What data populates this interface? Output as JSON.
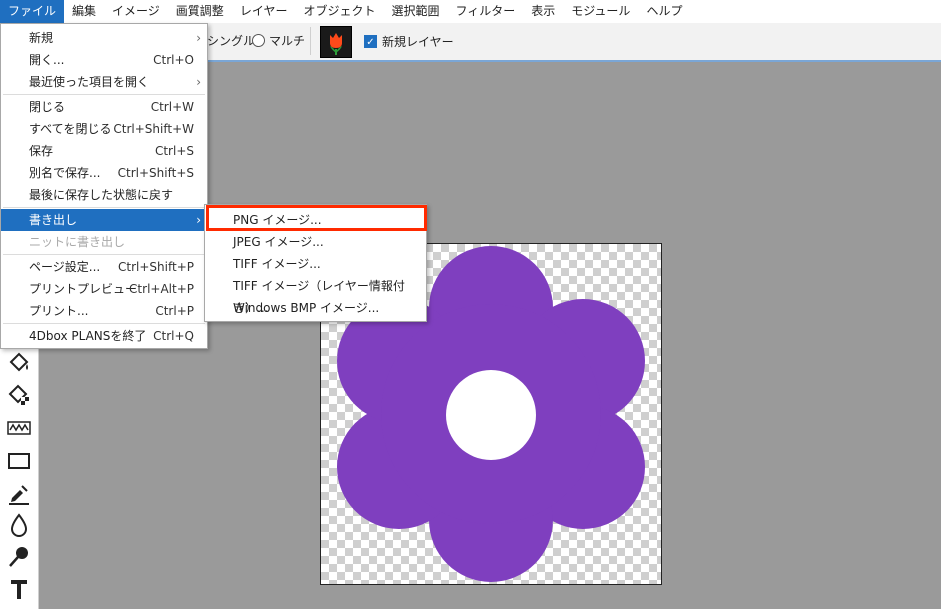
{
  "menubar": {
    "items": [
      "ファイル",
      "編集",
      "イメージ",
      "画質調整",
      "レイヤー",
      "オブジェクト",
      "選択範囲",
      "フィルター",
      "表示",
      "モジュール",
      "ヘルプ"
    ]
  },
  "toolbar": {
    "single_label": "シングル",
    "multi_label": "マルチ",
    "new_layer_label": "新規レイヤー",
    "new_layer_checked": true
  },
  "file_menu": {
    "items": [
      {
        "label": "新規",
        "shortcut": "",
        "submenu": true
      },
      {
        "label": "開く...",
        "shortcut": "Ctrl+O",
        "submenu": false
      },
      {
        "label": "最近使った項目を開く",
        "shortcut": "",
        "submenu": true
      },
      {
        "label": "閉じる",
        "shortcut": "Ctrl+W",
        "submenu": false
      },
      {
        "label": "すべてを閉じる",
        "shortcut": "Ctrl+Shift+W",
        "submenu": false
      },
      {
        "label": "保存",
        "shortcut": "Ctrl+S",
        "submenu": false
      },
      {
        "label": "別名で保存...",
        "shortcut": "Ctrl+Shift+S",
        "submenu": false
      },
      {
        "label": "最後に保存した状態に戻す",
        "shortcut": "",
        "submenu": false
      },
      {
        "label": "書き出し",
        "shortcut": "",
        "submenu": true
      },
      {
        "label": "ニットに書き出し",
        "shortcut": "",
        "submenu": false
      },
      {
        "label": "ページ設定...",
        "shortcut": "Ctrl+Shift+P",
        "submenu": false
      },
      {
        "label": "プリントプレビュー",
        "shortcut": "Ctrl+Alt+P",
        "submenu": false
      },
      {
        "label": "プリント...",
        "shortcut": "Ctrl+P",
        "submenu": false
      },
      {
        "label": "4Dbox PLANSを終了",
        "shortcut": "Ctrl+Q",
        "submenu": false
      }
    ]
  },
  "export_submenu": {
    "items": [
      "PNG イメージ...",
      "JPEG イメージ...",
      "TIFF イメージ...",
      "TIFF イメージ（レイヤー情報付き）...",
      "Windows BMP イメージ..."
    ]
  },
  "colors": {
    "accent": "#1f6fc0",
    "highlight_border": "#ff2a00",
    "flower": "#7f3fbf",
    "workspace": "#9a9a9a"
  }
}
